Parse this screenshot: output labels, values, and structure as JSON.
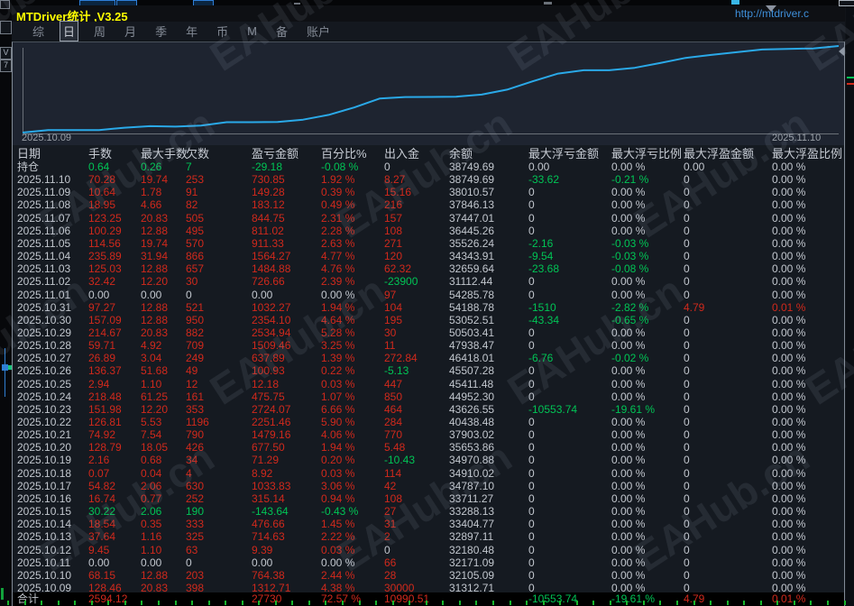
{
  "titlebar": {
    "title": "MTDriver统计 ,V3.25",
    "url": "http://mtdriver.c"
  },
  "menu": {
    "items": [
      "综",
      "日",
      "周",
      "月",
      "季",
      "年",
      "币",
      "M",
      "备",
      "账户"
    ],
    "selected": "日"
  },
  "colors": {
    "r": "#d0291c",
    "g": "#00c455",
    "w": "#c2c7ce",
    "line": "#2aa9e8",
    "axis": "#6a7078",
    "title_yellow": "#ffff00",
    "url_blue": "#3e8ed8"
  },
  "chart_data": {
    "type": "line",
    "title": "",
    "xlabel": "",
    "ylabel": "",
    "legend": "none",
    "grid": false,
    "x_start_label": "2025.10.09",
    "x_end_label": "2025.11.10",
    "x": [
      "2025.10.09",
      "2025.10.10",
      "2025.10.11",
      "2025.10.12",
      "2025.10.13",
      "2025.10.14",
      "2025.10.15",
      "2025.10.16",
      "2025.10.17",
      "2025.10.18",
      "2025.10.19",
      "2025.10.20",
      "2025.10.21",
      "2025.10.22",
      "2025.10.23",
      "2025.10.24",
      "2025.10.25",
      "2025.10.26",
      "2025.10.27",
      "2025.10.28",
      "2025.10.29",
      "2025.10.30",
      "2025.10.31",
      "2025.11.01",
      "2025.11.02",
      "2025.11.03",
      "2025.11.04",
      "2025.11.05",
      "2025.11.06",
      "2025.11.07",
      "2025.11.08",
      "2025.11.09",
      "2025.11.10"
    ],
    "series": [
      {
        "name": "cumulative-profit",
        "values": [
          1312.71,
          2077.09,
          2077.09,
          2086.48,
          2801.11,
          3277.77,
          3134.13,
          3449.27,
          4483.1,
          4492.02,
          4563.31,
          5240.81,
          6719.97,
          8971.43,
          11695.5,
          12171.25,
          12183.43,
          12284.36,
          12922.25,
          14431.71,
          16966.65,
          19320.75,
          20353.02,
          20353.02,
          21079.68,
          22564.56,
          24128.83,
          25040.16,
          25851.18,
          26695.93,
          26879.05,
          27028.33,
          27759.18
        ]
      }
    ]
  },
  "table": {
    "headers": [
      "日期",
      "手数",
      "最大手数",
      "欠数",
      "盈亏金额",
      "百分比%",
      "出入金",
      "余额",
      "最大浮亏金额",
      "最大浮亏比例",
      "最大浮盈金额",
      "最大浮盈比例"
    ],
    "rows": [
      {
        "cells": [
          "持仓",
          "0.64",
          "0.26",
          "7",
          "-29.18",
          "-0.08 %",
          "0",
          "38749.69",
          "0.00",
          "0.00 %",
          "0.00",
          "0.00 %"
        ],
        "colors": [
          "w",
          "g",
          "g",
          "g",
          "g",
          "g",
          "w",
          "w",
          "w",
          "w",
          "w",
          "w"
        ]
      },
      {
        "cells": [
          "2025.11.10",
          "70.28",
          "19.74",
          "253",
          "730.85",
          "1.92 %",
          "8.27",
          "38749.69",
          "-33.62",
          "-0.21 %",
          "0",
          "0.00 %"
        ],
        "colors": [
          "w",
          "r",
          "r",
          "r",
          "r",
          "r",
          "r",
          "w",
          "g",
          "g",
          "w",
          "w"
        ]
      },
      {
        "cells": [
          "2025.11.09",
          "10.64",
          "1.78",
          "91",
          "149.28",
          "0.39 %",
          "15.16",
          "38010.57",
          "0",
          "0.00 %",
          "0",
          "0.00 %"
        ],
        "colors": [
          "w",
          "r",
          "r",
          "r",
          "r",
          "r",
          "r",
          "w",
          "w",
          "w",
          "w",
          "w"
        ]
      },
      {
        "cells": [
          "2025.11.08",
          "18.95",
          "4.66",
          "82",
          "183.12",
          "0.49 %",
          "216",
          "37846.13",
          "0",
          "0.00 %",
          "0",
          "0.00 %"
        ],
        "colors": [
          "w",
          "r",
          "r",
          "r",
          "r",
          "r",
          "r",
          "w",
          "w",
          "w",
          "w",
          "w"
        ]
      },
      {
        "cells": [
          "2025.11.07",
          "123.25",
          "20.83",
          "505",
          "844.75",
          "2.31 %",
          "157",
          "37447.01",
          "0",
          "0.00 %",
          "0",
          "0.00 %"
        ],
        "colors": [
          "w",
          "r",
          "r",
          "r",
          "r",
          "r",
          "r",
          "w",
          "w",
          "w",
          "w",
          "w"
        ]
      },
      {
        "cells": [
          "2025.11.06",
          "100.29",
          "12.88",
          "495",
          "811.02",
          "2.28 %",
          "108",
          "36445.26",
          "0",
          "0.00 %",
          "0",
          "0.00 %"
        ],
        "colors": [
          "w",
          "r",
          "r",
          "r",
          "r",
          "r",
          "r",
          "w",
          "w",
          "w",
          "w",
          "w"
        ]
      },
      {
        "cells": [
          "2025.11.05",
          "114.56",
          "19.74",
          "570",
          "911.33",
          "2.63 %",
          "271",
          "35526.24",
          "-2.16",
          "-0.03 %",
          "0",
          "0.00 %"
        ],
        "colors": [
          "w",
          "r",
          "r",
          "r",
          "r",
          "r",
          "r",
          "w",
          "g",
          "g",
          "w",
          "w"
        ]
      },
      {
        "cells": [
          "2025.11.04",
          "235.89",
          "31.94",
          "866",
          "1564.27",
          "4.77 %",
          "120",
          "34343.91",
          "-9.54",
          "-0.03 %",
          "0",
          "0.00 %"
        ],
        "colors": [
          "w",
          "r",
          "r",
          "r",
          "r",
          "r",
          "r",
          "w",
          "g",
          "g",
          "w",
          "w"
        ]
      },
      {
        "cells": [
          "2025.11.03",
          "125.03",
          "12.88",
          "657",
          "1484.88",
          "4.76 %",
          "62.32",
          "32659.64",
          "-23.68",
          "-0.08 %",
          "0",
          "0.00 %"
        ],
        "colors": [
          "w",
          "r",
          "r",
          "r",
          "r",
          "r",
          "r",
          "w",
          "g",
          "g",
          "w",
          "w"
        ]
      },
      {
        "cells": [
          "2025.11.02",
          "32.42",
          "12.20",
          "30",
          "726.66",
          "2.39 %",
          "-23900",
          "31112.44",
          "0",
          "0.00 %",
          "0",
          "0.00 %"
        ],
        "colors": [
          "w",
          "r",
          "r",
          "r",
          "r",
          "r",
          "g",
          "w",
          "w",
          "w",
          "w",
          "w"
        ]
      },
      {
        "cells": [
          "2025.11.01",
          "0.00",
          "0.00",
          "0",
          "0.00",
          "0.00 %",
          "97",
          "54285.78",
          "0",
          "0.00 %",
          "0",
          "0.00 %"
        ],
        "colors": [
          "w",
          "w",
          "w",
          "w",
          "w",
          "w",
          "r",
          "w",
          "w",
          "w",
          "w",
          "w"
        ]
      },
      {
        "cells": [
          "2025.10.31",
          "97.27",
          "12.88",
          "521",
          "1032.27",
          "1.94 %",
          "104",
          "54188.78",
          "-1510",
          "-2.82 %",
          "4.79",
          "0.01 %"
        ],
        "colors": [
          "w",
          "r",
          "r",
          "r",
          "r",
          "r",
          "r",
          "w",
          "g",
          "g",
          "r",
          "r"
        ]
      },
      {
        "cells": [
          "2025.10.30",
          "157.09",
          "12.88",
          "950",
          "2354.10",
          "4.64 %",
          "195",
          "53052.51",
          "-43.34",
          "-0.65 %",
          "0",
          "0.00 %"
        ],
        "colors": [
          "w",
          "r",
          "r",
          "r",
          "r",
          "r",
          "r",
          "w",
          "g",
          "g",
          "w",
          "w"
        ]
      },
      {
        "cells": [
          "2025.10.29",
          "214.67",
          "20.83",
          "882",
          "2534.94",
          "5.28 %",
          "30",
          "50503.41",
          "0",
          "0.00 %",
          "0",
          "0.00 %"
        ],
        "colors": [
          "w",
          "r",
          "r",
          "r",
          "r",
          "r",
          "r",
          "w",
          "w",
          "w",
          "w",
          "w"
        ]
      },
      {
        "cells": [
          "2025.10.28",
          "59.71",
          "4.92",
          "709",
          "1509.46",
          "3.25 %",
          "11",
          "47938.47",
          "0",
          "0.00 %",
          "0",
          "0.00 %"
        ],
        "colors": [
          "w",
          "r",
          "r",
          "r",
          "r",
          "r",
          "r",
          "w",
          "w",
          "w",
          "w",
          "w"
        ]
      },
      {
        "cells": [
          "2025.10.27",
          "26.89",
          "3.04",
          "249",
          "637.89",
          "1.39 %",
          "272.84",
          "46418.01",
          "-6.76",
          "-0.02 %",
          "0",
          "0.00 %"
        ],
        "colors": [
          "w",
          "r",
          "r",
          "r",
          "r",
          "r",
          "r",
          "w",
          "g",
          "g",
          "w",
          "w"
        ]
      },
      {
        "cells": [
          "2025.10.26",
          "136.37",
          "51.68",
          "49",
          "100.93",
          "0.22 %",
          "-5.13",
          "45507.28",
          "0",
          "0.00 %",
          "0",
          "0.00 %"
        ],
        "colors": [
          "w",
          "r",
          "r",
          "r",
          "r",
          "r",
          "g",
          "w",
          "w",
          "w",
          "w",
          "w"
        ]
      },
      {
        "cells": [
          "2025.10.25",
          "2.94",
          "1.10",
          "12",
          "12.18",
          "0.03 %",
          "447",
          "45411.48",
          "0",
          "0.00 %",
          "0",
          "0.00 %"
        ],
        "colors": [
          "w",
          "r",
          "r",
          "r",
          "r",
          "r",
          "r",
          "w",
          "w",
          "w",
          "w",
          "w"
        ]
      },
      {
        "cells": [
          "2025.10.24",
          "218.48",
          "61.25",
          "161",
          "475.75",
          "1.07 %",
          "850",
          "44952.30",
          "0",
          "0.00 %",
          "0",
          "0.00 %"
        ],
        "colors": [
          "w",
          "r",
          "r",
          "r",
          "r",
          "r",
          "r",
          "w",
          "w",
          "w",
          "w",
          "w"
        ]
      },
      {
        "cells": [
          "2025.10.23",
          "151.98",
          "12.20",
          "353",
          "2724.07",
          "6.66 %",
          "464",
          "43626.55",
          "-10553.74",
          "-19.61 %",
          "0",
          "0.00 %"
        ],
        "colors": [
          "w",
          "r",
          "r",
          "r",
          "r",
          "r",
          "r",
          "w",
          "g",
          "g",
          "w",
          "w"
        ]
      },
      {
        "cells": [
          "2025.10.22",
          "126.81",
          "5.53",
          "1196",
          "2251.46",
          "5.90 %",
          "284",
          "40438.48",
          "0",
          "0.00 %",
          "0",
          "0.00 %"
        ],
        "colors": [
          "w",
          "r",
          "r",
          "r",
          "r",
          "r",
          "r",
          "w",
          "w",
          "w",
          "w",
          "w"
        ]
      },
      {
        "cells": [
          "2025.10.21",
          "74.92",
          "7.54",
          "790",
          "1479.16",
          "4.06 %",
          "770",
          "37903.02",
          "0",
          "0.00 %",
          "0",
          "0.00 %"
        ],
        "colors": [
          "w",
          "r",
          "r",
          "r",
          "r",
          "r",
          "r",
          "w",
          "w",
          "w",
          "w",
          "w"
        ]
      },
      {
        "cells": [
          "2025.10.20",
          "128.79",
          "18.05",
          "426",
          "677.50",
          "1.94 %",
          "5.48",
          "35653.86",
          "0",
          "0.00 %",
          "0",
          "0.00 %"
        ],
        "colors": [
          "w",
          "r",
          "r",
          "r",
          "r",
          "r",
          "r",
          "w",
          "w",
          "w",
          "w",
          "w"
        ]
      },
      {
        "cells": [
          "2025.10.19",
          "2.16",
          "0.68",
          "34",
          "71.29",
          "0.20 %",
          "-10.43",
          "34970.88",
          "0",
          "0.00 %",
          "0",
          "0.00 %"
        ],
        "colors": [
          "w",
          "r",
          "r",
          "r",
          "r",
          "r",
          "g",
          "w",
          "w",
          "w",
          "w",
          "w"
        ]
      },
      {
        "cells": [
          "2025.10.18",
          "0.07",
          "0.04",
          "4",
          "8.92",
          "0.03 %",
          "114",
          "34910.02",
          "0",
          "0.00 %",
          "0",
          "0.00 %"
        ],
        "colors": [
          "w",
          "r",
          "r",
          "r",
          "r",
          "r",
          "r",
          "w",
          "w",
          "w",
          "w",
          "w"
        ]
      },
      {
        "cells": [
          "2025.10.17",
          "54.82",
          "2.06",
          "630",
          "1033.83",
          "3.06 %",
          "42",
          "34787.10",
          "0",
          "0.00 %",
          "0",
          "0.00 %"
        ],
        "colors": [
          "w",
          "r",
          "r",
          "r",
          "r",
          "r",
          "r",
          "w",
          "w",
          "w",
          "w",
          "w"
        ]
      },
      {
        "cells": [
          "2025.10.16",
          "16.74",
          "0.77",
          "252",
          "315.14",
          "0.94 %",
          "108",
          "33711.27",
          "0",
          "0.00 %",
          "0",
          "0.00 %"
        ],
        "colors": [
          "w",
          "r",
          "r",
          "r",
          "r",
          "r",
          "r",
          "w",
          "w",
          "w",
          "w",
          "w"
        ]
      },
      {
        "cells": [
          "2025.10.15",
          "30.22",
          "2.06",
          "190",
          "-143.64",
          "-0.43 %",
          "27",
          "33288.13",
          "0",
          "0.00 %",
          "0",
          "0.00 %"
        ],
        "colors": [
          "w",
          "g",
          "g",
          "g",
          "g",
          "g",
          "r",
          "w",
          "w",
          "w",
          "w",
          "w"
        ]
      },
      {
        "cells": [
          "2025.10.14",
          "18.54",
          "0.35",
          "333",
          "476.66",
          "1.45 %",
          "31",
          "33404.77",
          "0",
          "0.00 %",
          "0",
          "0.00 %"
        ],
        "colors": [
          "w",
          "r",
          "r",
          "r",
          "r",
          "r",
          "r",
          "w",
          "w",
          "w",
          "w",
          "w"
        ]
      },
      {
        "cells": [
          "2025.10.13",
          "37.64",
          "1.16",
          "325",
          "714.63",
          "2.22 %",
          "2",
          "32897.11",
          "0",
          "0.00 %",
          "0",
          "0.00 %"
        ],
        "colors": [
          "w",
          "r",
          "r",
          "r",
          "r",
          "r",
          "r",
          "w",
          "w",
          "w",
          "w",
          "w"
        ]
      },
      {
        "cells": [
          "2025.10.12",
          "9.45",
          "1.10",
          "63",
          "9.39",
          "0.03 %",
          "0",
          "32180.48",
          "0",
          "0.00 %",
          "0",
          "0.00 %"
        ],
        "colors": [
          "w",
          "r",
          "r",
          "r",
          "r",
          "r",
          "w",
          "w",
          "w",
          "w",
          "w",
          "w"
        ]
      },
      {
        "cells": [
          "2025.10.11",
          "0.00",
          "0.00",
          "0",
          "0.00",
          "0.00 %",
          "66",
          "32171.09",
          "0",
          "0.00 %",
          "0",
          "0.00 %"
        ],
        "colors": [
          "w",
          "w",
          "w",
          "w",
          "w",
          "w",
          "r",
          "w",
          "w",
          "w",
          "w",
          "w"
        ]
      },
      {
        "cells": [
          "2025.10.10",
          "68.15",
          "12.88",
          "203",
          "764.38",
          "2.44 %",
          "28",
          "32105.09",
          "0",
          "0.00 %",
          "0",
          "0.00 %"
        ],
        "colors": [
          "w",
          "r",
          "r",
          "r",
          "r",
          "r",
          "r",
          "w",
          "w",
          "w",
          "w",
          "w"
        ]
      },
      {
        "cells": [
          "2025.10.09",
          "128.46",
          "20.83",
          "398",
          "1312.71",
          "4.38 %",
          "30000",
          "31312.71",
          "0",
          "0.00 %",
          "0",
          "0.00 %"
        ],
        "colors": [
          "w",
          "r",
          "r",
          "r",
          "r",
          "r",
          "r",
          "w",
          "w",
          "w",
          "w",
          "w"
        ]
      }
    ],
    "total_row": {
      "cells": [
        "合计",
        "2594.12",
        "",
        "",
        "27730",
        "72.57 %",
        "10990.51",
        "",
        "-10553.74",
        "-19.61 %",
        "4.79",
        "0.01 %"
      ],
      "colors": [
        "w",
        "r",
        "w",
        "w",
        "r",
        "r",
        "r",
        "w",
        "g",
        "g",
        "r",
        "r"
      ]
    }
  },
  "decor": {
    "watermark_text": "EAHub.cn"
  }
}
